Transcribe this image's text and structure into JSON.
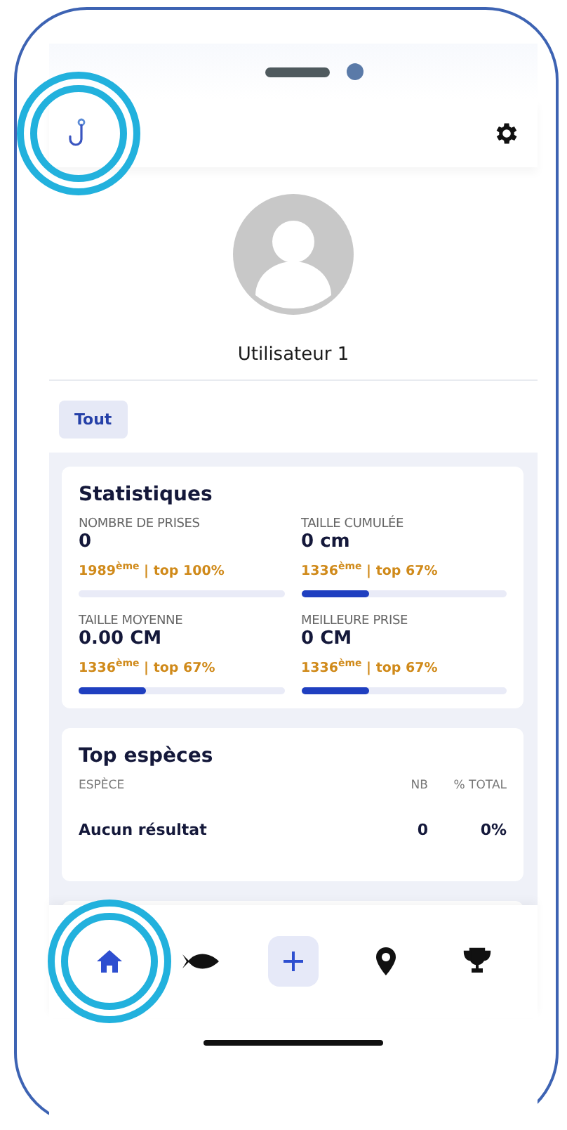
{
  "header": {
    "logo_highlighted": true
  },
  "profile": {
    "name": "Utilisateur 1"
  },
  "filters": [
    {
      "label": "Tout",
      "selected": true
    }
  ],
  "statistics": {
    "title": "Statistiques",
    "items": [
      {
        "label": "NOMBRE DE PRISES",
        "value": "0",
        "rank": "1989$^{ème}$ | top 100%",
        "level": 0
      },
      {
        "label": "TAILLE CUMULÉE",
        "value": "0 cm",
        "rank": "1336$^{ème}$ | top 67%",
        "level": 0.33
      },
      {
        "label": "TAILLE MOYENNE",
        "value": "0.00 CM",
        "rank": "1336$^{ème}$ | top 67%",
        "level": 0.33
      },
      {
        "label": "MEILLEURE PRISE",
        "value": "0 CM",
        "rank": "1336$^{ème}$ | top 67%",
        "level": 0.33
      }
    ]
  },
  "top_species": {
    "title": "Top espèces",
    "columns": [
      "ESPÈCE",
      "NB",
      "% TOTAL"
    ],
    "rows": [
      [
        "Aucun résultat",
        "0",
        "0%"
      ]
    ]
  },
  "nav": [
    {
      "kind": "home",
      "selected": true,
      "highlighted": true
    },
    {
      "kind": "fish",
      "selected": false,
      "highlighted": false
    },
    {
      "kind": "add",
      "selected": false,
      "highlighted": false
    },
    {
      "kind": "pin",
      "selected": false,
      "highlighted": false
    },
    {
      "kind": "trophy",
      "selected": false,
      "highlighted": false
    }
  ]
}
